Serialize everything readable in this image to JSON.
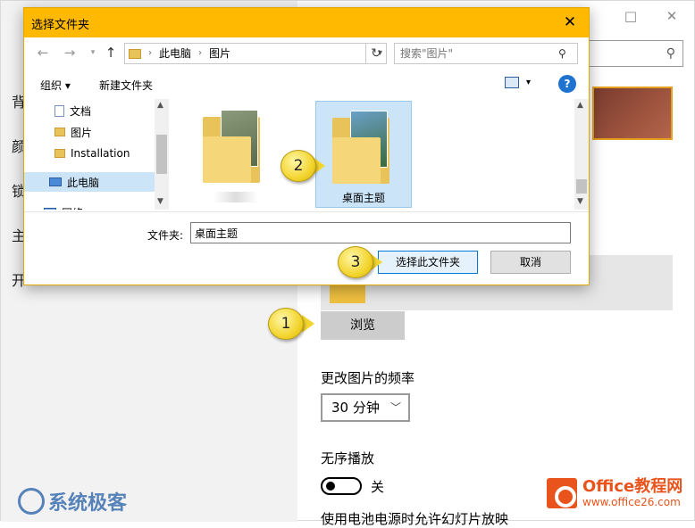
{
  "settings": {
    "nav_items": [
      "背",
      "颜",
      "锁",
      "主",
      "开"
    ],
    "browse_button": "浏览",
    "frequency_label": "更改图片的频率",
    "frequency_value": "30 分钟",
    "shuffle_label": "无序播放",
    "toggle_state_label": "关",
    "battery_label": "使用电池电源时允许幻灯片放映"
  },
  "dialog": {
    "title": "选择文件夹",
    "breadcrumb": [
      "此电脑",
      "图片"
    ],
    "search_placeholder": "搜索\"图片\"",
    "toolbar": {
      "organize": "组织 ▾",
      "new_folder": "新建文件夹"
    },
    "nav_tree": [
      {
        "label": "文档",
        "icon": "document-icon",
        "pinned": true
      },
      {
        "label": "图片",
        "icon": "folder-icon",
        "pinned": true
      },
      {
        "label": "Installation",
        "icon": "folder-icon",
        "pinned": true
      },
      {
        "label": "此电脑",
        "icon": "computer-icon",
        "selected": true
      },
      {
        "label": "网络",
        "icon": "network-icon"
      }
    ],
    "folders": [
      {
        "label": "",
        "selected": false
      },
      {
        "label": "桌面主题",
        "selected": true
      }
    ],
    "folder_field_label": "文件夹:",
    "folder_field_value": "桌面主题",
    "select_button": "选择此文件夹",
    "cancel_button": "取消"
  },
  "callouts": [
    "1",
    "2",
    "3"
  ],
  "watermarks": {
    "left": "系统极客",
    "right_title": "Office教程网",
    "right_sub": "www.office26.com"
  },
  "colors": {
    "dialog_titlebar": "#ffb900",
    "selection": "#cce4f7",
    "callout": "#f3d530",
    "help": "#1e73d0"
  }
}
